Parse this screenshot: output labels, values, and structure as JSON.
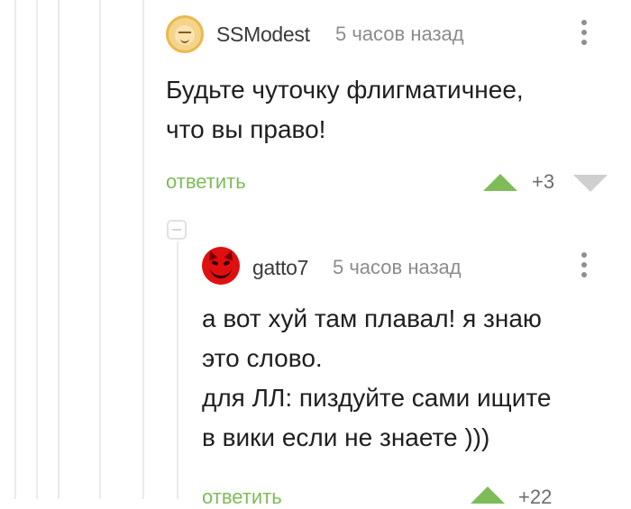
{
  "comments": [
    {
      "author": "SSModest",
      "time": "5 часов назад",
      "text_lines": [
        "Будьте чуточку флигматичнее,",
        "что вы право!"
      ],
      "reply_label": "ответить",
      "rating": "+3"
    },
    {
      "author": "gatto7",
      "time": "5 часов назад",
      "text_lines": [
        "а вот хуй там плавал! я знаю",
        "это слово.",
        "для ЛЛ: пиздуйте сами ищите",
        "в вики если не знаете )))"
      ],
      "reply_label": "ответить",
      "rating": "+22"
    }
  ],
  "colors": {
    "accent_green": "#7ebc59",
    "vote_down_gray": "#cfcfcf",
    "muted_text": "#8c8c8c"
  },
  "icons": {
    "upvote": "triangle-up-icon",
    "downvote": "triangle-down-icon",
    "menu": "vertical-dots-icon",
    "collapse": "minus-box-icon"
  }
}
